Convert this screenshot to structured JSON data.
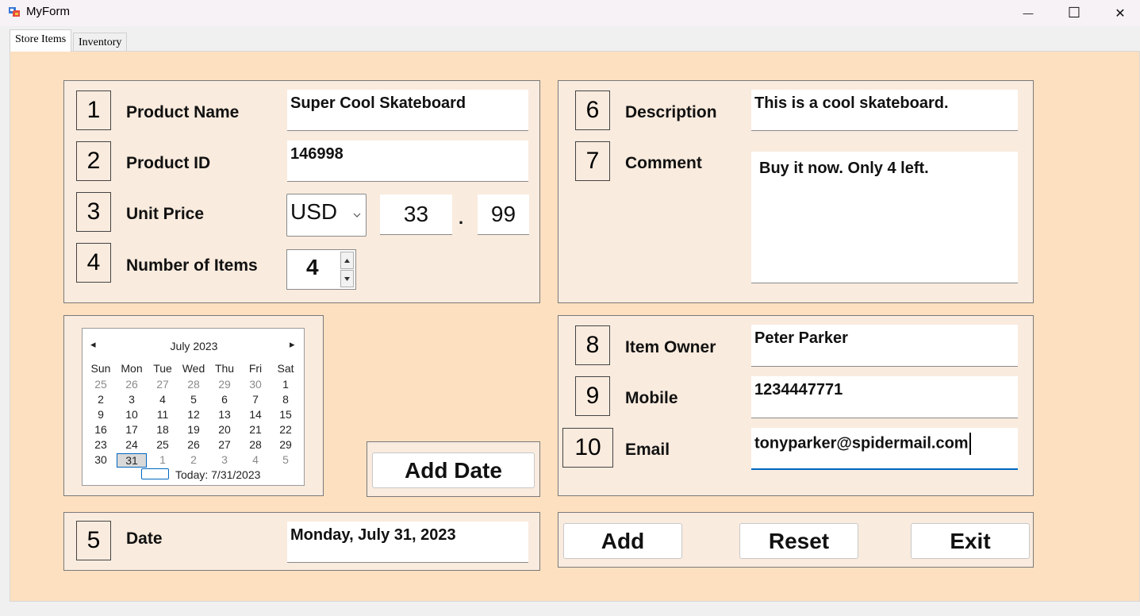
{
  "window": {
    "title": "MyForm",
    "minimize_glyph": "—",
    "maximize_glyph": "☐",
    "close_glyph": "✕"
  },
  "tabs": [
    {
      "label": "Store Items",
      "active": true
    },
    {
      "label": "Inventory",
      "active": false
    }
  ],
  "fields": {
    "product_name": {
      "num": "1",
      "label": "Product Name",
      "value": "Super Cool Skateboard"
    },
    "product_id": {
      "num": "2",
      "label": "Product ID",
      "value": "146998"
    },
    "unit_price": {
      "num": "3",
      "label": "Unit Price",
      "currency": "USD",
      "whole": "33",
      "separator": ".",
      "cents": "99"
    },
    "number_of_items": {
      "num": "4",
      "label": "Number of Items",
      "value": "4"
    },
    "date": {
      "num": "5",
      "label": "Date",
      "value": "Monday, July 31, 2023"
    },
    "description": {
      "num": "6",
      "label": "Description",
      "value": "This is a cool skateboard."
    },
    "comment": {
      "num": "7",
      "label": "Comment",
      "value": "Buy it now. Only 4 left."
    },
    "item_owner": {
      "num": "8",
      "label": "Item Owner",
      "value": "Peter Parker"
    },
    "mobile": {
      "num": "9",
      "label": "Mobile",
      "value": "1234447771"
    },
    "email": {
      "num": "10",
      "label": "Email",
      "value": "tonyparker@spidermail.com"
    }
  },
  "calendar": {
    "month_label": "July 2023",
    "prev_glyph": "◂",
    "next_glyph": "▸",
    "day_headers": [
      "Sun",
      "Mon",
      "Tue",
      "Wed",
      "Thu",
      "Fri",
      "Sat"
    ],
    "weeks": [
      [
        "25",
        "26",
        "27",
        "28",
        "29",
        "30",
        "1"
      ],
      [
        "2",
        "3",
        "4",
        "5",
        "6",
        "7",
        "8"
      ],
      [
        "9",
        "10",
        "11",
        "12",
        "13",
        "14",
        "15"
      ],
      [
        "16",
        "17",
        "18",
        "19",
        "20",
        "21",
        "22"
      ],
      [
        "23",
        "24",
        "25",
        "26",
        "27",
        "28",
        "29"
      ],
      [
        "30",
        "31",
        "1",
        "2",
        "3",
        "4",
        "5"
      ]
    ],
    "selected_day": "31",
    "today_label": "Today: 7/31/2023"
  },
  "buttons": {
    "add_date": "Add Date",
    "add": "Add",
    "reset": "Reset",
    "exit": "Exit"
  },
  "colors": {
    "form_background": "#fde0c0",
    "panel_background": "#f9ebde",
    "focus_underline": "#0067c0"
  }
}
